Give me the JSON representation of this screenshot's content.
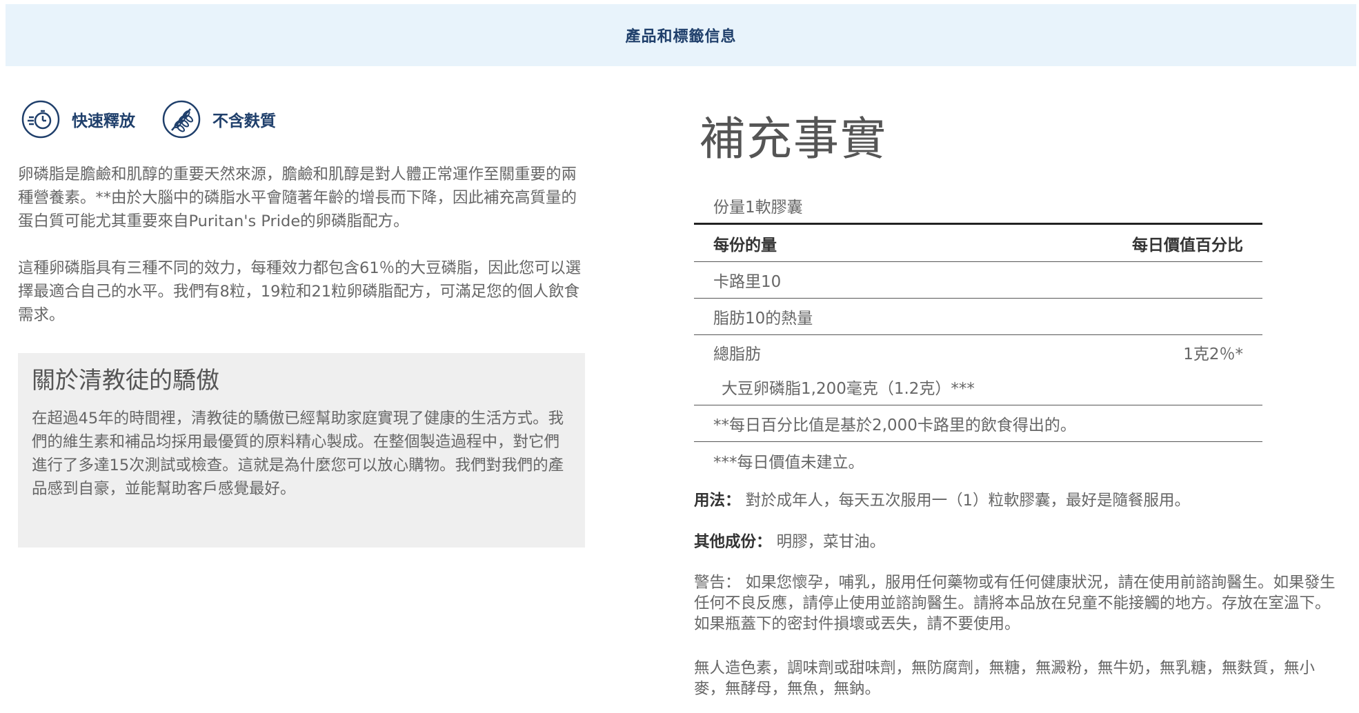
{
  "header": {
    "title": "產品和標籤信息"
  },
  "badges": [
    {
      "icon": "stopwatch-icon",
      "label": "快速釋放"
    },
    {
      "icon": "wheat-free-icon",
      "label": "不含麩質"
    }
  ],
  "intro": {
    "p1": "卵磷脂是膽鹼和肌醇的重要天然來源，膽鹼和肌醇是對人體正常運作至關重要的兩種營養素。**由於大腦中的磷脂水平會隨著年齡的增長而下降，因此補充高質量的蛋白質可能尤其重要來自Puritan's Pride的卵磷脂配方。",
    "p2": "這種卵磷脂具有三種不同的效力，每種效力都包含61％的大豆磷脂，因此您可以選擇最適合自己的水平。我們有8粒，19粒和21粒卵磷脂配方，可滿足您的個人飲食需求。"
  },
  "about": {
    "title": "關於清教徒的驕傲",
    "body": "在超過45年的時間裡，清教徒的驕傲已經幫助家庭實現了健康的生活方式。我們的維生素和補品均採用最優質的原料精心製成。在整個製造過程中，對它們進行了多達15次測試或檢查。這就是為什麼您可以放心購物。我們對我們的產品感到自豪，並能幫助客戶感覺最好。"
  },
  "facts": {
    "title": "補充事實",
    "serving": "份量1軟膠囊",
    "head_left": "每份的量",
    "head_right": "每日價值百分比",
    "calories": "卡路里10",
    "fat_calories": "脂肪10的熱量",
    "total_fat": "總脂肪",
    "total_fat_value": "1克2％*",
    "soy_lecithin": "大豆卵磷脂1,200毫克（1.2克）***",
    "footnote1": "**每日百分比值是基於2,000卡路里的飲食得出的。",
    "footnote2": "***每日價值未建立。"
  },
  "usage": {
    "label": "用法：",
    "text": " 對於成年人，每天五次服用一（1）粒軟膠囊，最好是隨餐服用。"
  },
  "other": {
    "label": "其他成份：",
    "text": " 明膠，菜甘油。"
  },
  "warning": "警告： 如果您懷孕，哺乳，服用任何藥物或有任何健康狀況，請在使用前諮詢醫生。如果發生任何不良反應，請停止使用並諮詢醫生。請將本品放在兒童不能接觸的地方。存放在室溫下。如果瓶蓋下的密封件損壞或丟失，請不要使用。",
  "free_from": "無人造色素，調味劑或甜味劑，無防腐劑，無糖，無澱粉，無牛奶，無乳糖，無麩質，無小麥，無酵母，無魚，無鈉。",
  "colors": {
    "accent": "#1f3f6b",
    "header_bg": "#e8f3fb",
    "box_bg": "#efefef"
  }
}
